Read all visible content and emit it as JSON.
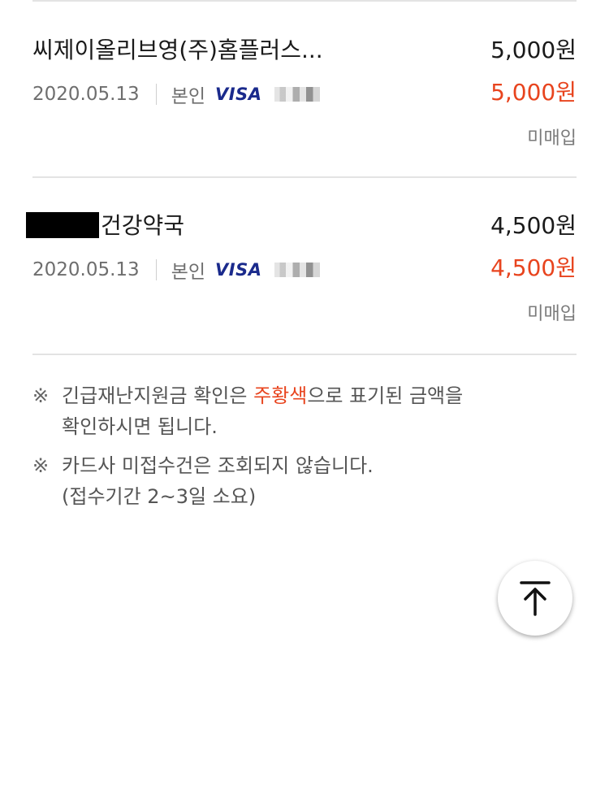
{
  "transactions": [
    {
      "merchant": "씨제이올리브영(주)홈플러스...",
      "date": "2020.05.13",
      "holder": "본인",
      "card_brand": "VISA",
      "card_masked": "",
      "amount": "5,000원",
      "approved_amount": "5,000원",
      "status": "미매입"
    },
    {
      "merchant": "건강약국",
      "date": "2020.05.13",
      "holder": "본인",
      "card_brand": "VISA",
      "card_masked": "",
      "amount": "4,500원",
      "approved_amount": "4,500원",
      "status": "미매입"
    }
  ],
  "notes": {
    "mark": "※",
    "note1_before": "긴급재난지원금 확인은 ",
    "note1_highlight": "주황색",
    "note1_after": "으로 표기된 금액을",
    "note1_line2": "확인하시면 됩니다.",
    "note2_line1": "카드사 미접수건은 조회되지 않습니다.",
    "note2_line2": "(접수기간 2~3일 소요)"
  },
  "colors": {
    "accent": "#e8441e",
    "visa": "#1a2a8c"
  },
  "icons": {
    "scroll_top": "arrow-up-to-line-icon"
  }
}
